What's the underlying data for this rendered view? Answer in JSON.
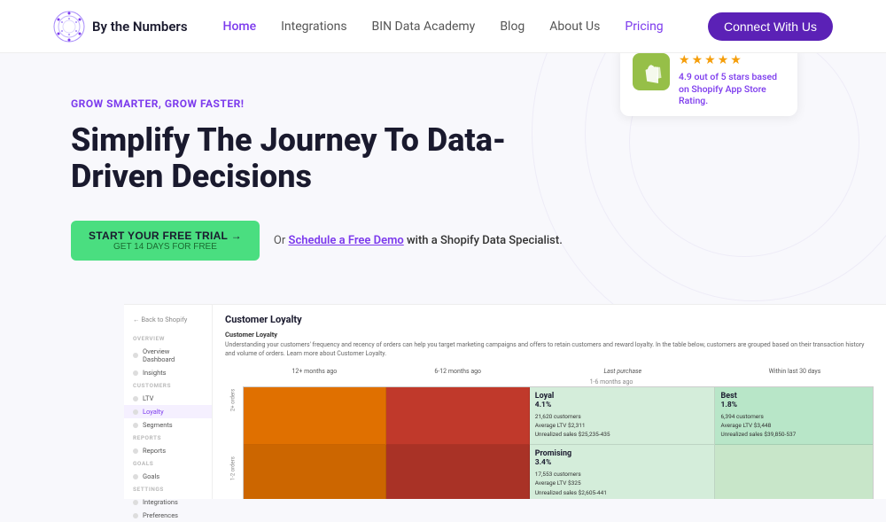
{
  "nav": {
    "logo_text": "By the Numbers",
    "links": [
      {
        "label": "Home",
        "active": true
      },
      {
        "label": "Integrations",
        "active": false
      },
      {
        "label": "BIN Data Academy",
        "active": false
      },
      {
        "label": "Blog",
        "active": false
      },
      {
        "label": "About Us",
        "active": false
      },
      {
        "label": "Pricing",
        "active": false,
        "highlight": true
      }
    ],
    "cta": "Connect With Us"
  },
  "hero": {
    "tagline": "GROW SMARTER, GROW FASTER!",
    "title": "Simplify The Journey To Data-Driven Decisions",
    "cta_button": "START YOUR FREE TRIAL →",
    "cta_sub": "GET 14 DAYS FOR FREE",
    "or_text": "Or",
    "demo_link": "Schedule a Free Demo",
    "demo_suffix": "with a Shopify Data Specialist."
  },
  "rating": {
    "score": "4.9 out of 5 stars based on Shopify App Store Rating."
  },
  "sidebar": {
    "back": "← Back to Shopify",
    "sections": [
      {
        "label": "OVERVIEW",
        "items": [
          {
            "label": "Overview Dashboard",
            "active": false
          },
          {
            "label": "Insights",
            "active": false
          }
        ]
      },
      {
        "label": "CUSTOMERS",
        "items": [
          {
            "label": "LTV",
            "active": false
          },
          {
            "label": "Loyalty",
            "active": true
          },
          {
            "label": "Segments",
            "active": false
          }
        ]
      },
      {
        "label": "REPORTS",
        "items": [
          {
            "label": "Reports",
            "active": false
          }
        ]
      },
      {
        "label": "GOALS",
        "items": [
          {
            "label": "Goals",
            "active": false
          }
        ]
      },
      {
        "label": "SETTINGS",
        "items": [
          {
            "label": "Integrations",
            "active": false
          },
          {
            "label": "Preferences",
            "active": false
          }
        ]
      }
    ]
  },
  "dashboard": {
    "title": "Customer Loyalty",
    "subtitle": "Customer Loyalty",
    "description": "Understanding your customers' frequency and recency of orders can help you target marketing campaigns and offers to retain customers and reward loyalty. In the table below, customers are grouped based on their transaction history and volume of orders. Learn more about Customer Loyalty.",
    "columns": [
      "12+ months ago",
      "6-12 months ago",
      "Last purchase",
      "1-6 months ago",
      "Within last 30 days"
    ],
    "segments": {
      "loyal": {
        "label": "Loyal",
        "pct": "4.1%",
        "customers": "21,620 customers",
        "avg_ltv": "Average LTV $2,311",
        "avg_sales": "Unrealized sales $25,235-435"
      },
      "best": {
        "label": "Best",
        "pct": "1.8%",
        "customers": "6,394 customers",
        "avg_ltv": "Average LTV $3,448",
        "avg_sales": "Unrealized sales $39,850-537"
      },
      "promising": {
        "label": "Promising",
        "pct": "3.4%",
        "customers": "17,553 customers",
        "avg_ltv": "Average LTV $325",
        "avg_sales": "Unrealized sales $2,605-441"
      }
    }
  }
}
